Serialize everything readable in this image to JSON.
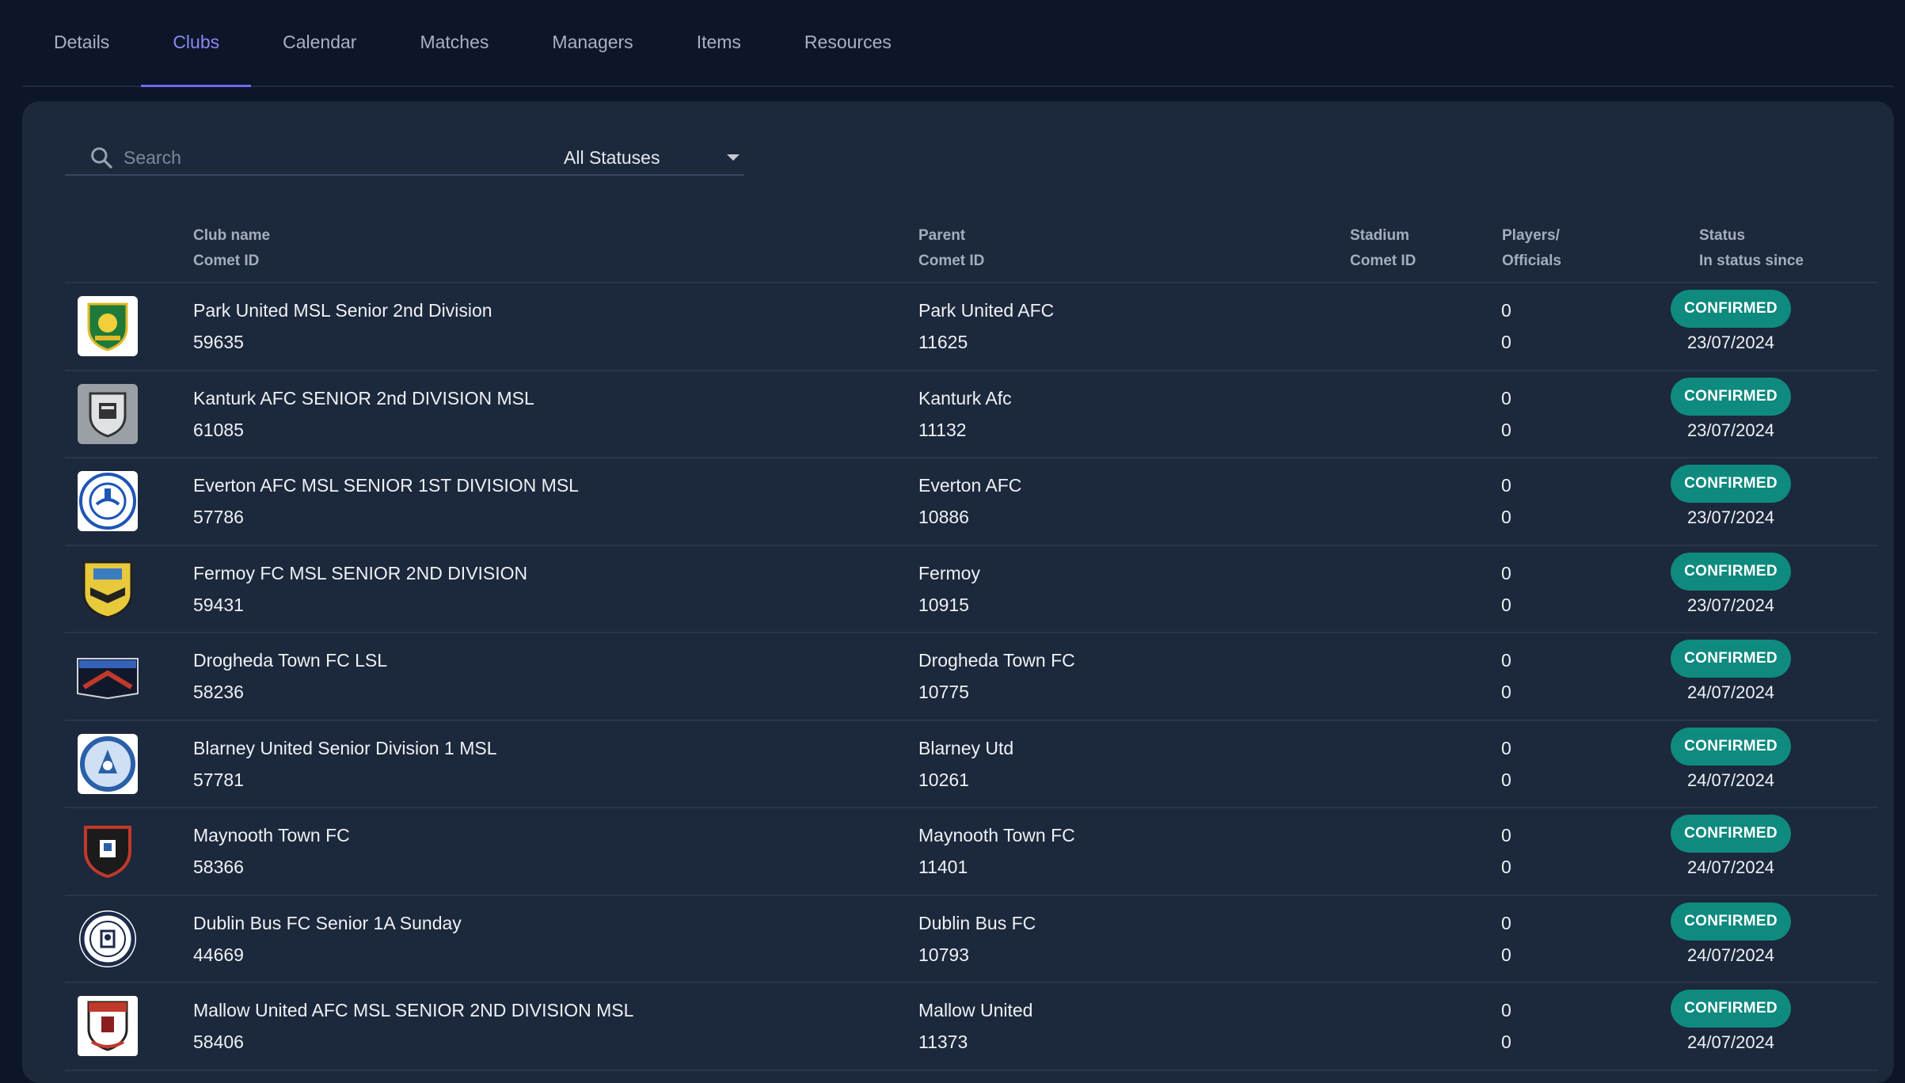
{
  "tabs": [
    {
      "label": "Details",
      "active": false
    },
    {
      "label": "Clubs",
      "active": true
    },
    {
      "label": "Calendar",
      "active": false
    },
    {
      "label": "Matches",
      "active": false
    },
    {
      "label": "Managers",
      "active": false
    },
    {
      "label": "Items",
      "active": false
    },
    {
      "label": "Resources",
      "active": false
    }
  ],
  "search": {
    "placeholder": "Search",
    "icon": "search-icon"
  },
  "status_filter": {
    "value": "All Statuses"
  },
  "columns": {
    "club_name": "Club name",
    "comet_id": "Comet ID",
    "parent": "Parent",
    "parent_comet_id": "Comet ID",
    "stadium": "Stadium",
    "stadium_comet_id": "Comet ID",
    "players": "Players/",
    "officials": "Officials",
    "status": "Status",
    "status_since": "In status since"
  },
  "colors": {
    "accent": "#6e69ef",
    "confirmed": "#0e8a7e",
    "card": "#1c283b",
    "background": "#0d1628"
  },
  "rows": [
    {
      "name": "Park United MSL Senior 2nd Division",
      "id": "59635",
      "parent": "Park United AFC",
      "parent_id": "11625",
      "players": "0",
      "officials": "0",
      "status": "CONFIRMED",
      "since": "23/07/2024",
      "logo": "shield-crest"
    },
    {
      "name": "Kanturk AFC SENIOR 2nd DIVISION MSL",
      "id": "61085",
      "parent": "Kanturk Afc",
      "parent_id": "11132",
      "players": "0",
      "officials": "0",
      "status": "CONFIRMED",
      "since": "23/07/2024",
      "logo": "grey-castle-crest"
    },
    {
      "name": "Everton AFC MSL SENIOR 1ST DIVISION MSL",
      "id": "57786",
      "parent": "Everton AFC",
      "parent_id": "10886",
      "players": "0",
      "officials": "0",
      "status": "CONFIRMED",
      "since": "23/07/2024",
      "logo": "blue-round-crest"
    },
    {
      "name": "Fermoy FC MSL SENIOR 2ND DIVISION",
      "id": "59431",
      "parent": "Fermoy",
      "parent_id": "10915",
      "players": "0",
      "officials": "0",
      "status": "CONFIRMED",
      "since": "23/07/2024",
      "logo": "yellow-shield-crest"
    },
    {
      "name": "Drogheda Town FC LSL",
      "id": "58236",
      "parent": "Drogheda Town FC",
      "parent_id": "10775",
      "players": "0",
      "officials": "0",
      "status": "CONFIRMED",
      "since": "24/07/2024",
      "logo": "banner-crest"
    },
    {
      "name": "Blarney United Senior Division 1 MSL",
      "id": "57781",
      "parent": "Blarney Utd",
      "parent_id": "10261",
      "players": "0",
      "officials": "0",
      "status": "CONFIRMED",
      "since": "24/07/2024",
      "logo": "blue-ring-crest"
    },
    {
      "name": "Maynooth Town FC",
      "id": "58366",
      "parent": "Maynooth Town FC",
      "parent_id": "11401",
      "players": "0",
      "officials": "0",
      "status": "CONFIRMED",
      "since": "24/07/2024",
      "logo": "red-shield-crest"
    },
    {
      "name": "Dublin Bus FC Senior 1A Sunday",
      "id": "44669",
      "parent": "Dublin Bus FC",
      "parent_id": "10793",
      "players": "0",
      "officials": "0",
      "status": "CONFIRMED",
      "since": "24/07/2024",
      "logo": "navy-round-crest"
    },
    {
      "name": "Mallow United AFC MSL SENIOR 2ND DIVISION MSL",
      "id": "58406",
      "parent": "Mallow United",
      "parent_id": "11373",
      "players": "0",
      "officials": "0",
      "status": "CONFIRMED",
      "since": "24/07/2024",
      "logo": "red-white-shield-crest"
    }
  ]
}
